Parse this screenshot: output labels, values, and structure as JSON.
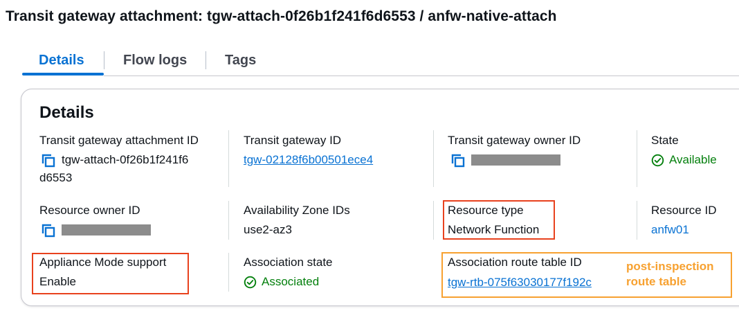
{
  "page": {
    "title": "Transit gateway attachment: tgw-attach-0f26b1f241f6d6553 / anfw-native-attach"
  },
  "tabs": [
    {
      "label": "Details",
      "active": true
    },
    {
      "label": "Flow logs",
      "active": false
    },
    {
      "label": "Tags",
      "active": false
    }
  ],
  "details": {
    "heading": "Details",
    "attachment_id": {
      "label": "Transit gateway attachment ID",
      "value_line1": "tgw-attach-0f26b1f241f6",
      "value_line2": "d6553"
    },
    "tgw_id": {
      "label": "Transit gateway ID",
      "value": "tgw-02128f6b00501ece4"
    },
    "tgw_owner": {
      "label": "Transit gateway owner ID"
    },
    "state": {
      "label": "State",
      "value": "Available"
    },
    "resource_owner": {
      "label": "Resource owner ID"
    },
    "az_ids": {
      "label": "Availability Zone IDs",
      "value": "use2-az3"
    },
    "resource_type": {
      "label": "Resource type",
      "value": "Network Function"
    },
    "resource_id": {
      "label": "Resource ID",
      "value": "anfw01"
    },
    "appliance_mode": {
      "label": "Appliance Mode support",
      "value": "Enable"
    },
    "association_state": {
      "label": "Association state",
      "value": "Associated"
    },
    "route_table": {
      "label": "Association route table ID",
      "value": "tgw-rtb-075f63030177f192c"
    }
  },
  "annotation": {
    "line1": "post-inspection",
    "line2": "route table"
  },
  "colors": {
    "accent": "#0972d3",
    "success": "#037f0c",
    "highlight_red": "#e8411d",
    "highlight_orange": "#f7a130"
  }
}
